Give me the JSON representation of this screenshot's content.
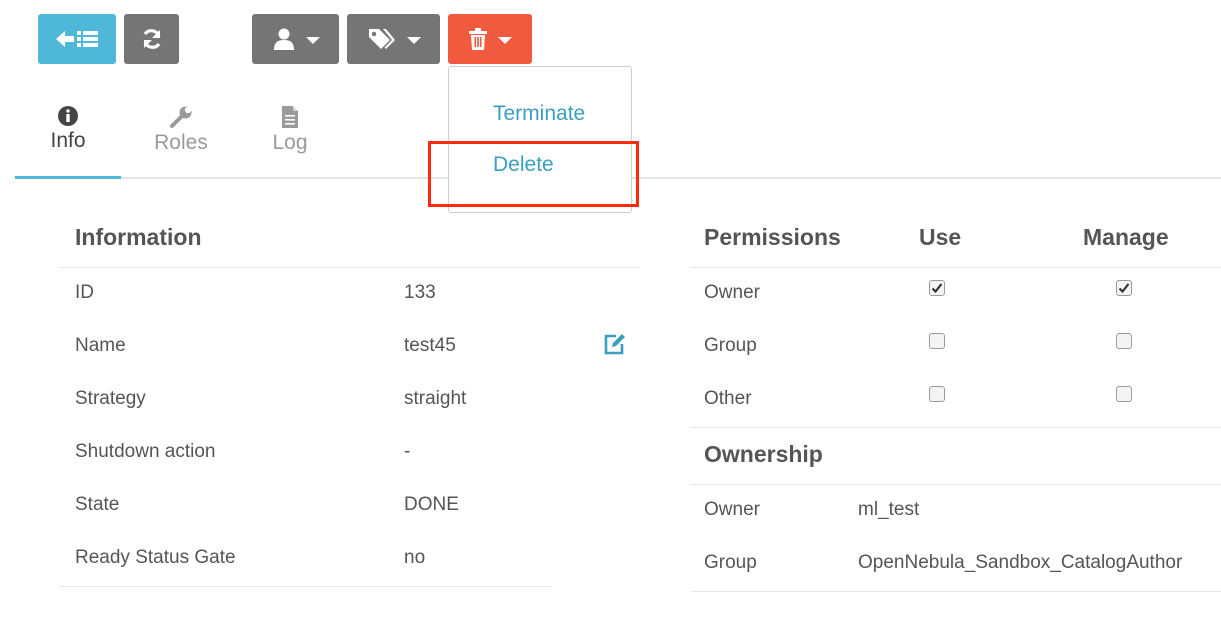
{
  "colors": {
    "primary": "#4fb7d8",
    "secondary": "#757575",
    "alert": "#f05a3e",
    "link": "#3a9ebf",
    "highlight_box": "#ff2a0f"
  },
  "toolbar": {
    "back_icon": "back-to-list-icon",
    "refresh_icon": "refresh-icon",
    "owner_icon": "user-icon",
    "labels_icon": "tags-icon",
    "delete_icon": "trash-icon",
    "caret_icon": "caret-down-icon"
  },
  "delete_menu": {
    "items": [
      {
        "label": "Terminate"
      },
      {
        "label": "Delete"
      }
    ],
    "highlighted": "Delete"
  },
  "tabs": [
    {
      "label": "Info",
      "icon": "info-icon",
      "active": true
    },
    {
      "label": "Roles",
      "icon": "wrench-icon",
      "active": false
    },
    {
      "label": "Log",
      "icon": "file-icon",
      "active": false
    }
  ],
  "information": {
    "title": "Information",
    "rows": [
      {
        "key": "ID",
        "value": "133"
      },
      {
        "key": "Name",
        "value": "test45"
      },
      {
        "key": "Strategy",
        "value": "straight"
      },
      {
        "key": "Shutdown action",
        "value": "-"
      },
      {
        "key": "State",
        "value": "DONE"
      },
      {
        "key": "Ready Status Gate",
        "value": "no"
      }
    ],
    "edit_icon": "edit-icon"
  },
  "permissions": {
    "title": "Permissions",
    "col_use": "Use",
    "col_manage": "Manage",
    "rows": [
      {
        "label": "Owner",
        "use": true,
        "manage": true
      },
      {
        "label": "Group",
        "use": false,
        "manage": false
      },
      {
        "label": "Other",
        "use": false,
        "manage": false
      }
    ]
  },
  "ownership": {
    "title": "Ownership",
    "rows": [
      {
        "key": "Owner",
        "value": "ml_test"
      },
      {
        "key": "Group",
        "value": "OpenNebula_Sandbox_CatalogAuthor"
      }
    ]
  }
}
